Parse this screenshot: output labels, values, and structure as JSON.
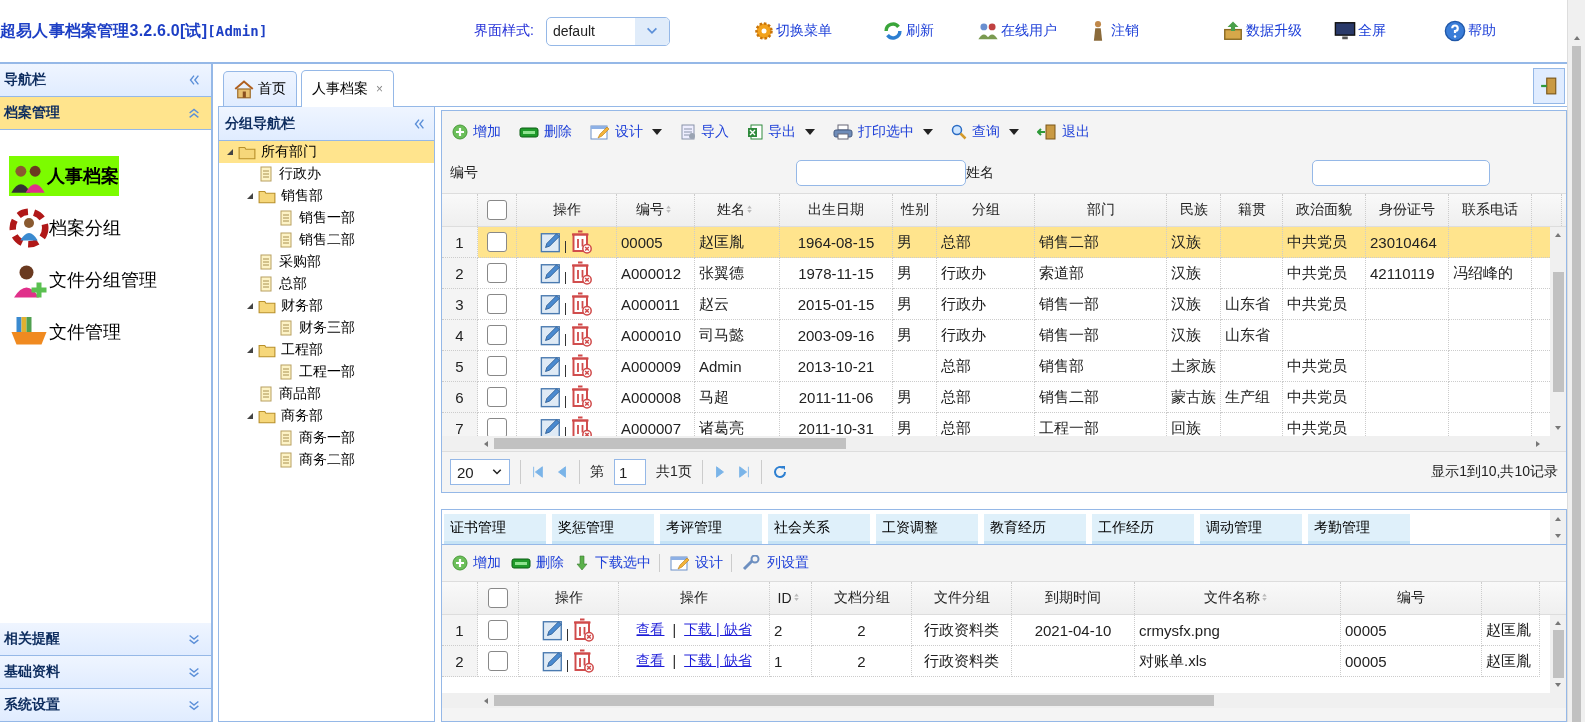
{
  "header": {
    "title": "超易人事档案管理3.2.6.0[试]",
    "user": "[Admin]",
    "style_label": "界面样式:",
    "style_value": "default",
    "actions": [
      {
        "kind": "switch-menu",
        "label": "切换菜单"
      },
      {
        "kind": "refresh",
        "label": "刷新"
      },
      {
        "kind": "online-users",
        "label": "在线用户"
      },
      {
        "kind": "logout",
        "label": "注销"
      },
      {
        "kind": "upgrade",
        "label": "数据升级"
      },
      {
        "kind": "fullscreen",
        "label": "全屏"
      },
      {
        "kind": "help",
        "label": "帮助"
      }
    ]
  },
  "sidebar": {
    "title": "导航栏",
    "sections": [
      {
        "label": "档案管理",
        "expanded": true,
        "items": [
          {
            "kind": "people",
            "label": "人事档案",
            "selected": true
          },
          {
            "kind": "group",
            "label": "档案分组",
            "selected": false
          },
          {
            "kind": "file-group",
            "label": "文件分组管理",
            "selected": false
          },
          {
            "kind": "files",
            "label": "文件管理",
            "selected": false
          }
        ]
      },
      {
        "label": "相关提醒",
        "expanded": false
      },
      {
        "label": "基础资料",
        "expanded": false
      },
      {
        "label": "系统设置",
        "expanded": false
      }
    ]
  },
  "tabs": [
    {
      "kind": "home",
      "label": "首页",
      "selected": false
    },
    {
      "kind": "page",
      "label": "人事档案",
      "selected": true,
      "close": "×"
    }
  ],
  "tree": {
    "title": "分组导航栏",
    "nodes": [
      {
        "label": "所有部门",
        "selected": true,
        "expanded": true,
        "children": [
          {
            "label": "行政办",
            "selected": false
          },
          {
            "label": "销售部",
            "selected": false,
            "expanded": true,
            "children": [
              {
                "label": "销售一部",
                "selected": false
              },
              {
                "label": "销售二部",
                "selected": false
              }
            ]
          },
          {
            "label": "采购部",
            "selected": false
          },
          {
            "label": "总部",
            "selected": false
          },
          {
            "label": "财务部",
            "selected": false,
            "expanded": true,
            "children": [
              {
                "label": "财务三部",
                "selected": false
              }
            ]
          },
          {
            "label": "工程部",
            "selected": false,
            "expanded": true,
            "children": [
              {
                "label": "工程一部",
                "selected": false
              }
            ]
          },
          {
            "label": "商品部",
            "selected": false
          },
          {
            "label": "商务部",
            "selected": false,
            "expanded": true,
            "children": [
              {
                "label": "商务一部",
                "selected": false
              },
              {
                "label": "商务二部",
                "selected": false
              }
            ]
          }
        ]
      }
    ]
  },
  "grid": {
    "toolbar": [
      {
        "kind": "add",
        "label": "增加",
        "dropdown": false
      },
      {
        "kind": "delete",
        "label": "删除",
        "dropdown": false
      },
      {
        "kind": "design",
        "label": "设计",
        "dropdown": true
      },
      {
        "kind": "import",
        "label": "导入",
        "dropdown": false
      },
      {
        "kind": "export",
        "label": "导出",
        "dropdown": true
      },
      {
        "kind": "print",
        "label": "打印选中",
        "dropdown": true
      },
      {
        "kind": "query",
        "label": "查询",
        "dropdown": true
      },
      {
        "kind": "exit",
        "label": "退出",
        "dropdown": false
      }
    ],
    "filters": [
      {
        "label": "编号"
      },
      {
        "label": "姓名"
      }
    ],
    "select_all_checked": false,
    "columns": [
      {
        "kind": "actions",
        "label": "操作"
      },
      {
        "kind": "text",
        "label": "编号",
        "sortable": true
      },
      {
        "kind": "text",
        "label": "姓名",
        "sortable": true
      },
      {
        "kind": "text",
        "label": "出生日期",
        "sortable": false
      },
      {
        "kind": "text",
        "label": "性别",
        "sortable": false
      },
      {
        "kind": "text",
        "label": "分组",
        "sortable": false
      },
      {
        "kind": "text",
        "label": "部门",
        "sortable": false
      },
      {
        "kind": "text",
        "label": "民族",
        "sortable": false
      },
      {
        "kind": "text",
        "label": "籍贯",
        "sortable": false
      },
      {
        "kind": "text",
        "label": "政治面貌",
        "sortable": false
      },
      {
        "kind": "text",
        "label": "身份证号",
        "sortable": false
      },
      {
        "kind": "text",
        "label": "联系电话",
        "sortable": false
      }
    ],
    "rows": [
      {
        "number": "1",
        "selected": true,
        "checked": false,
        "cells": [
          "",
          "00005",
          "赵匡胤",
          "1964-08-15",
          "男",
          "总部",
          "销售二部",
          "汉族",
          "",
          "中共党员",
          "23010464",
          ""
        ]
      },
      {
        "number": "2",
        "selected": false,
        "checked": false,
        "cells": [
          "",
          "A000012",
          "张翼德",
          "1978-11-15",
          "男",
          "行政办",
          "索道部",
          "汉族",
          "",
          "中共党员",
          "42110119",
          "冯绍峰的"
        ]
      },
      {
        "number": "3",
        "selected": false,
        "checked": false,
        "cells": [
          "",
          "A000011",
          "赵云",
          "2015-01-15",
          "男",
          "行政办",
          "销售一部",
          "汉族",
          "山东省",
          "中共党员",
          "",
          ""
        ]
      },
      {
        "number": "4",
        "selected": false,
        "checked": false,
        "cells": [
          "",
          "A000010",
          "司马懿",
          "2003-09-16",
          "男",
          "行政办",
          "销售一部",
          "汉族",
          "山东省",
          "",
          "",
          ""
        ]
      },
      {
        "number": "5",
        "selected": false,
        "checked": false,
        "cells": [
          "",
          "A000009",
          "Admin",
          "2013-10-21",
          "",
          "总部",
          "销售部",
          "土家族",
          "",
          "中共党员",
          "",
          ""
        ]
      },
      {
        "number": "6",
        "selected": false,
        "checked": false,
        "cells": [
          "",
          "A000008",
          "马超",
          "2011-11-06",
          "男",
          "总部",
          "销售二部",
          "蒙古族",
          "生产组",
          "中共党员",
          "",
          ""
        ]
      },
      {
        "number": "7",
        "selected": false,
        "checked": false,
        "cells": [
          "",
          "A000007",
          "诸葛亮",
          "2011-10-31",
          "男",
          "总部",
          "工程一部",
          "回族",
          "",
          "中共党员",
          "",
          ""
        ]
      }
    ]
  },
  "pager": {
    "page_size": "20",
    "page_prefix": "第",
    "page": "1",
    "page_total": "共1页",
    "summary": "显示1到10,共10记录"
  },
  "detail": {
    "tabs": [
      {
        "label": "证书管理"
      },
      {
        "label": "奖惩管理"
      },
      {
        "label": "考评管理"
      },
      {
        "label": "社会关系"
      },
      {
        "label": "工资调整"
      },
      {
        "label": "教育经历"
      },
      {
        "label": "工作经历"
      },
      {
        "label": "调动管理"
      },
      {
        "label": "考勤管理"
      }
    ],
    "toolbar": [
      {
        "kind": "add",
        "label": "增加",
        "dropdown": false
      },
      {
        "kind": "delete",
        "label": "删除",
        "dropdown": false
      },
      {
        "kind": "download",
        "label": "下载选中",
        "dropdown": false
      },
      {
        "kind": "design",
        "label": "设计",
        "dropdown": false
      },
      {
        "kind": "columns",
        "label": "列设置",
        "dropdown": false
      }
    ],
    "select_all_checked": false,
    "columns": [
      {
        "kind": "actions",
        "label": "操作"
      },
      {
        "kind": "links",
        "label": "操作"
      },
      {
        "kind": "text",
        "label": "ID",
        "sortable": true
      },
      {
        "kind": "text",
        "label": "文档分组",
        "sortable": false
      },
      {
        "kind": "text",
        "label": "文件分组",
        "sortable": false
      },
      {
        "kind": "text",
        "label": "到期时间",
        "sortable": false
      },
      {
        "kind": "text",
        "label": "文件名称",
        "sortable": true
      },
      {
        "kind": "text",
        "label": "编号",
        "sortable": false
      },
      {
        "kind": "text",
        "sortable": false
      }
    ],
    "rows": [
      {
        "number": "1",
        "selected": false,
        "checked": false,
        "links": [
          "查看",
          "下载 | 缺省"
        ],
        "link_separator": "|",
        "cells": [
          "",
          "",
          "2",
          "2",
          "行政资料类",
          "2021-04-10",
          "crmysfx.png",
          "00005",
          "赵匡胤"
        ]
      },
      {
        "number": "2",
        "selected": false,
        "checked": false,
        "links": [
          "查看",
          "下载 | 缺省"
        ],
        "link_separator": "|",
        "cells": [
          "",
          "",
          "1",
          "2",
          "行政资料类",
          "",
          "对账单.xls",
          "00005",
          "赵匡胤"
        ]
      }
    ]
  }
}
